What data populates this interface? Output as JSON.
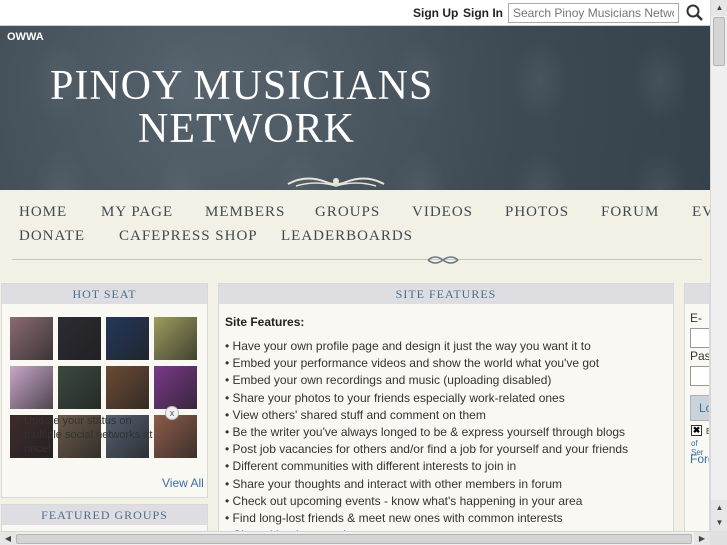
{
  "topbar": {
    "signup_label": "Sign Up",
    "signin_label": "Sign In",
    "search_placeholder": "Search Pinoy Musicians Network",
    "search_icon": "magnifier-icon"
  },
  "header": {
    "tag": "OWWA",
    "title_line1": "PINOY MUSICIANS",
    "title_line2": "NETWORK"
  },
  "nav": {
    "items": [
      "HOME",
      "MY PAGE",
      "MEMBERS",
      "GROUPS",
      "VIDEOS",
      "PHOTOS",
      "FORUM",
      "EV",
      "DONATE",
      "CAFEPRESS SHOP",
      "LEADERBOARDS"
    ]
  },
  "hotseat": {
    "title": "HOT SEAT",
    "status_text": "Update your status on multiple social networks at once!",
    "close_label": "x",
    "view_all": "View All",
    "thumb_colors": [
      "#8a6b72",
      "#2b2b33",
      "#24385a",
      "#9c9c5e",
      "#c8a7c9",
      "#3a4a3f",
      "#6b4b35",
      "#7a3a8a",
      "#3d2b2b",
      "#6a5a4a",
      "#556070",
      "#8c5c4a"
    ]
  },
  "featured_groups": {
    "title": "FEATURED GROUPS"
  },
  "site_features": {
    "title": "SITE FEATURES",
    "heading": "Site Features:",
    "items": [
      "Have your own profile page and design it just the way you want it to",
      "Embed your performance videos and show the world what you've got",
      "Embed your own recordings and music (uploading disabled)",
      "Share your photos to your friends especially work-related ones",
      "View others' shared stuff and comment on them",
      "Be the writer you've always longed to be & express yourself through blogs",
      "Post job vacancies for others and/or find a job for yourself and your friends",
      "Different communities with different interests to join in",
      "Share your thoughts and interact with other members in forum",
      "Check out upcoming events - know what's happening in your area",
      "Find long-lost friends & meet new ones with common interests",
      "Chat with other members"
    ]
  },
  "login": {
    "email_label": "E-ma",
    "password_label": "Pass",
    "button_label": "Lo",
    "remember_label": "B",
    "tos_label": "of Ser",
    "forgot_label": "Forg"
  }
}
